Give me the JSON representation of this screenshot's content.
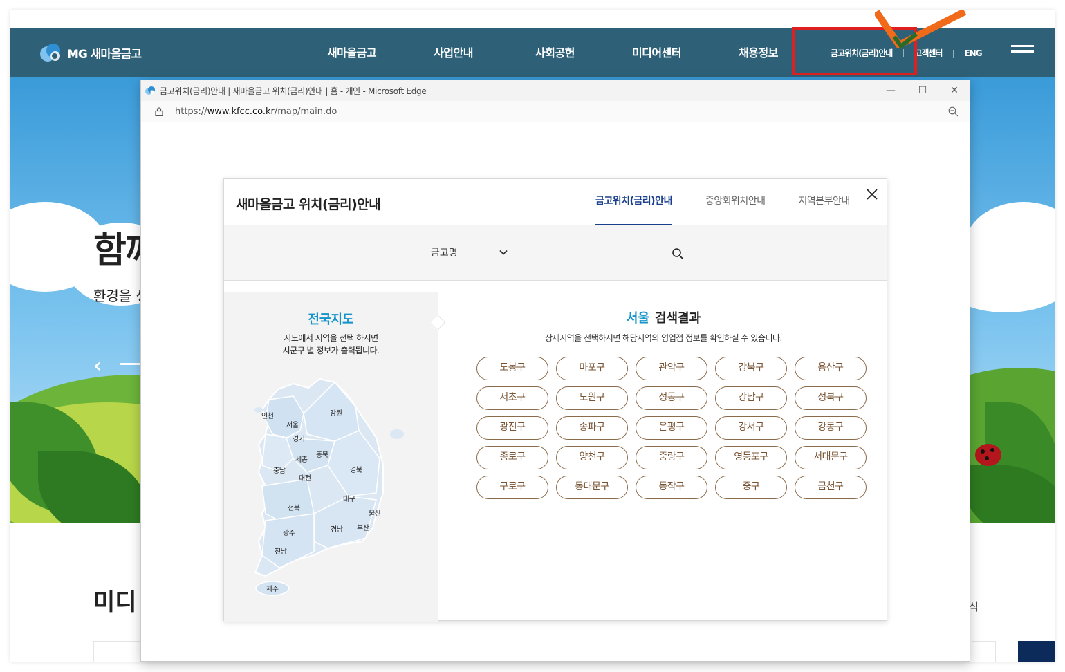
{
  "site": {
    "logo_text": "MG 새마을금고",
    "nav": [
      "새마을금고",
      "사업안내",
      "사회공헌",
      "미디어센터",
      "채용정보"
    ],
    "util": [
      "금고위치(금리)안내",
      "고객센터",
      "ENG"
    ],
    "hero_title": "함께",
    "hero_sub": "환경을 생",
    "hero_prev": "‹",
    "media_title": "미디",
    "side_text": "식"
  },
  "browser": {
    "title": "금고위치(금리)안내 | 새마을금고 위치(금리)안내 | 홈 - 개인 - Microsoft Edge",
    "url_prefix": "https://",
    "url_domain": "www.kfcc.co.kr",
    "url_path": "/map/main.do",
    "minimize": "—",
    "maximize": "☐",
    "close": "✕"
  },
  "modal": {
    "title": "새마을금고 위치(금리)안내",
    "tabs": [
      {
        "label": "금고위치(금리)안내",
        "active": true
      },
      {
        "label": "중앙회위치안내",
        "active": false
      },
      {
        "label": "지역본부안내",
        "active": false
      }
    ],
    "search": {
      "select_value": "금고명",
      "input_value": "",
      "input_placeholder": ""
    },
    "map": {
      "title": "전국지도",
      "desc_line1": "지도에서 지역을 선택 하시면",
      "desc_line2": "시군구 별 정보가 출력됩니다.",
      "regions": [
        "인천",
        "서울",
        "경기",
        "강원",
        "세종",
        "충북",
        "충남",
        "대전",
        "경북",
        "대구",
        "울산",
        "전북",
        "경남",
        "부산",
        "광주",
        "전남",
        "제주"
      ]
    },
    "result": {
      "city": "서울",
      "title_suffix": "검색결과",
      "desc": "상세지역을 선택하시면 해당지역의 영업점 정보를 확인하실 수 있습니다.",
      "districts": [
        "도봉구",
        "마포구",
        "관악구",
        "강북구",
        "용산구",
        "서초구",
        "노원구",
        "성동구",
        "강남구",
        "성북구",
        "광진구",
        "송파구",
        "은평구",
        "강서구",
        "강동구",
        "종로구",
        "양천구",
        "중랑구",
        "영등포구",
        "서대문구",
        "구로구",
        "동대문구",
        "동작구",
        "중구",
        "금천구"
      ]
    }
  },
  "colors": {
    "gnb": "#2e6178",
    "accent_blue": "#1493c9",
    "active_tab": "#1a3f8c",
    "district_border": "#8b6a4a",
    "highlight": "#e02020"
  }
}
